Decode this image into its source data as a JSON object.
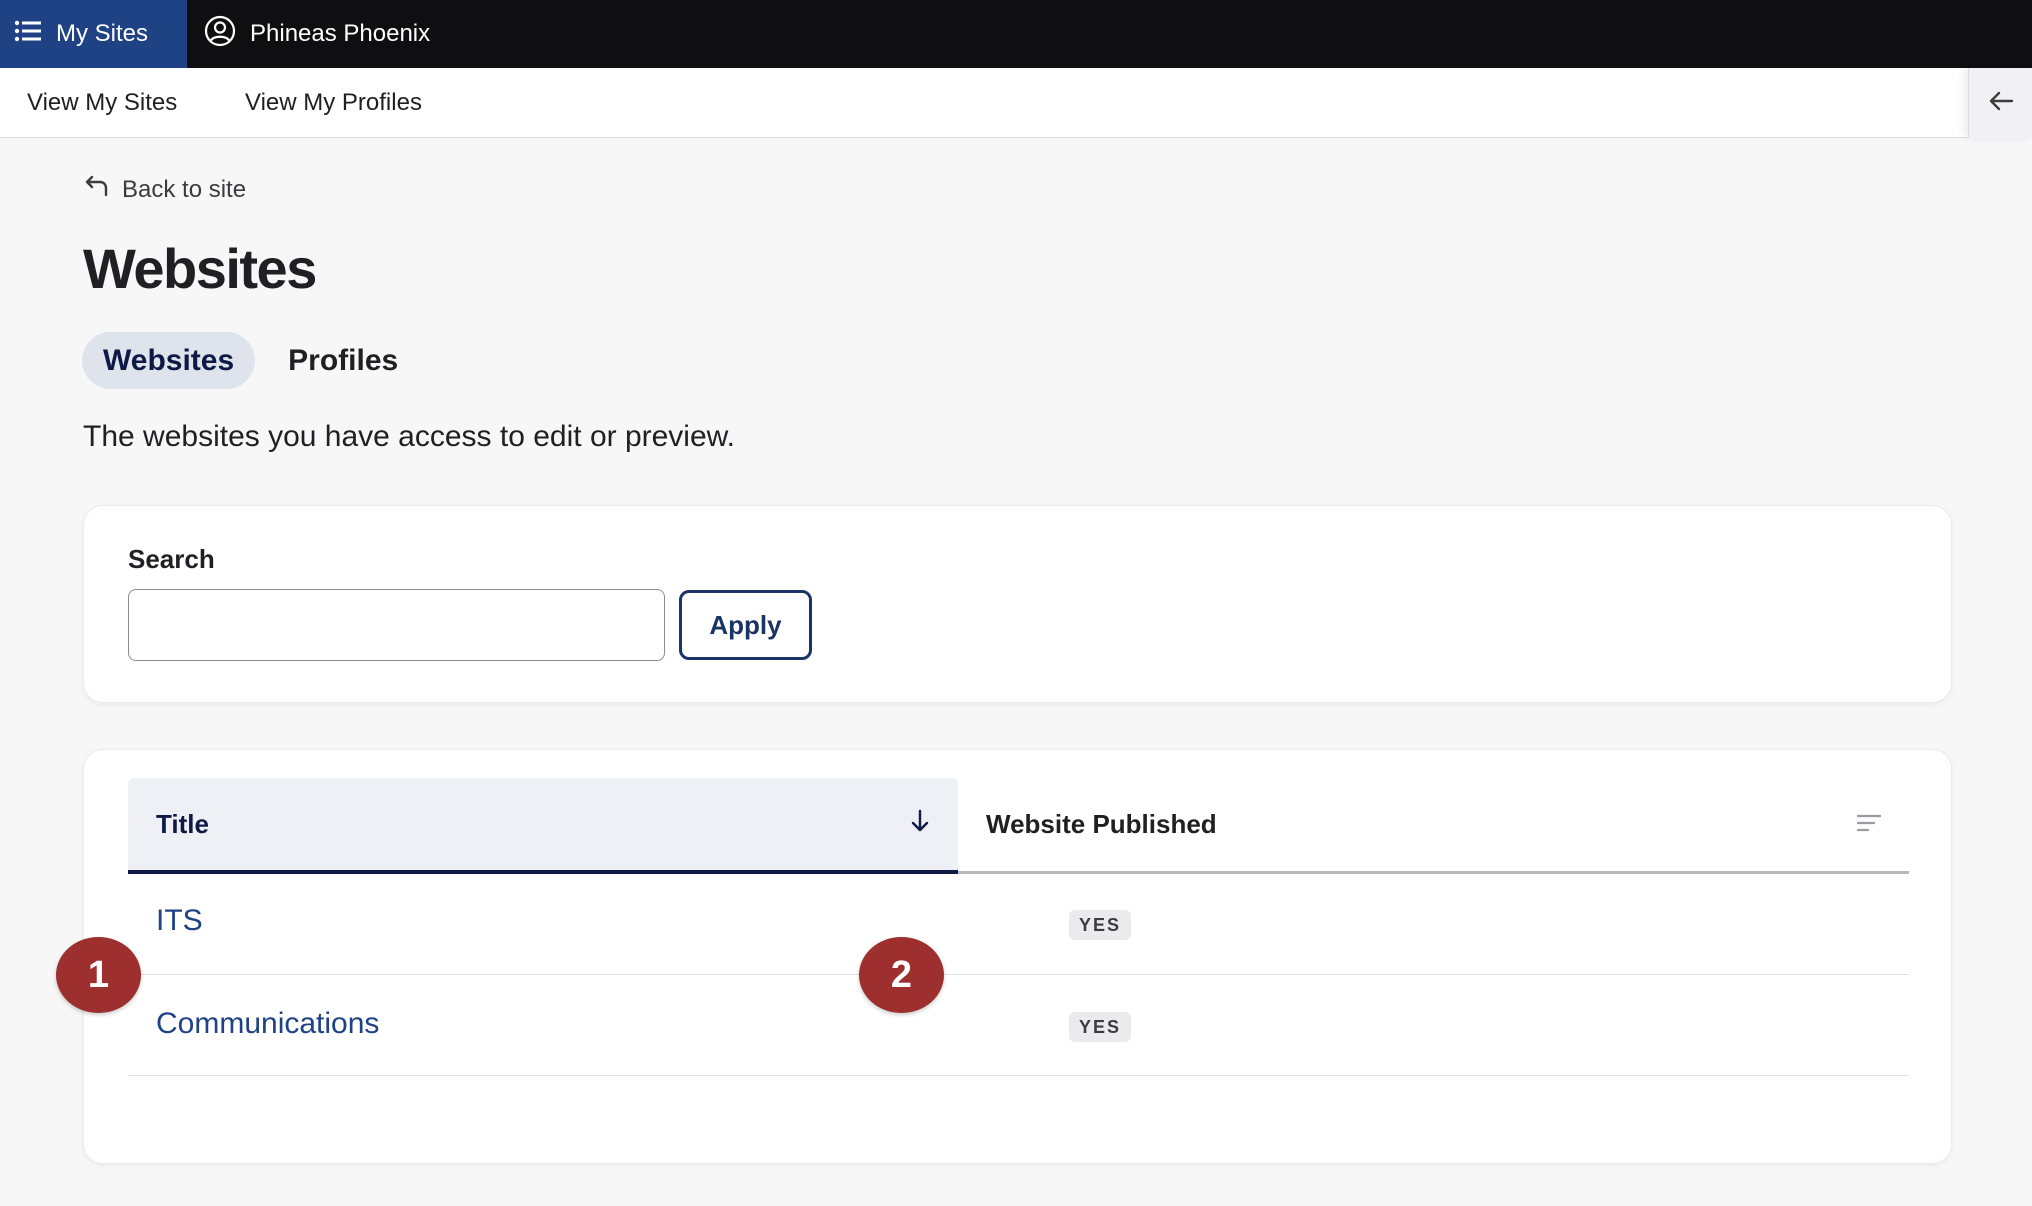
{
  "topbar": {
    "menu_label": "My Sites",
    "user_name": "Phineas Phoenix"
  },
  "subnav": {
    "link1": "View My Sites",
    "link2": "View My Profiles"
  },
  "back_label": "Back to site",
  "page_title": "Websites",
  "tabs": [
    {
      "label": "Websites",
      "active": true
    },
    {
      "label": "Profiles",
      "active": false
    }
  ],
  "description": "The websites you have access to edit or preview.",
  "search": {
    "label": "Search",
    "value": "",
    "apply_label": "Apply"
  },
  "table": {
    "columns": [
      "Title",
      "Website Published"
    ],
    "rows": [
      {
        "title": "ITS",
        "published": "YES"
      },
      {
        "title": "Communications",
        "published": "YES"
      }
    ]
  },
  "markers": [
    "1",
    "2"
  ],
  "colors": {
    "topbar": "#0f0f11",
    "accent": "#1e4283",
    "marker": "#9e2f2f"
  }
}
